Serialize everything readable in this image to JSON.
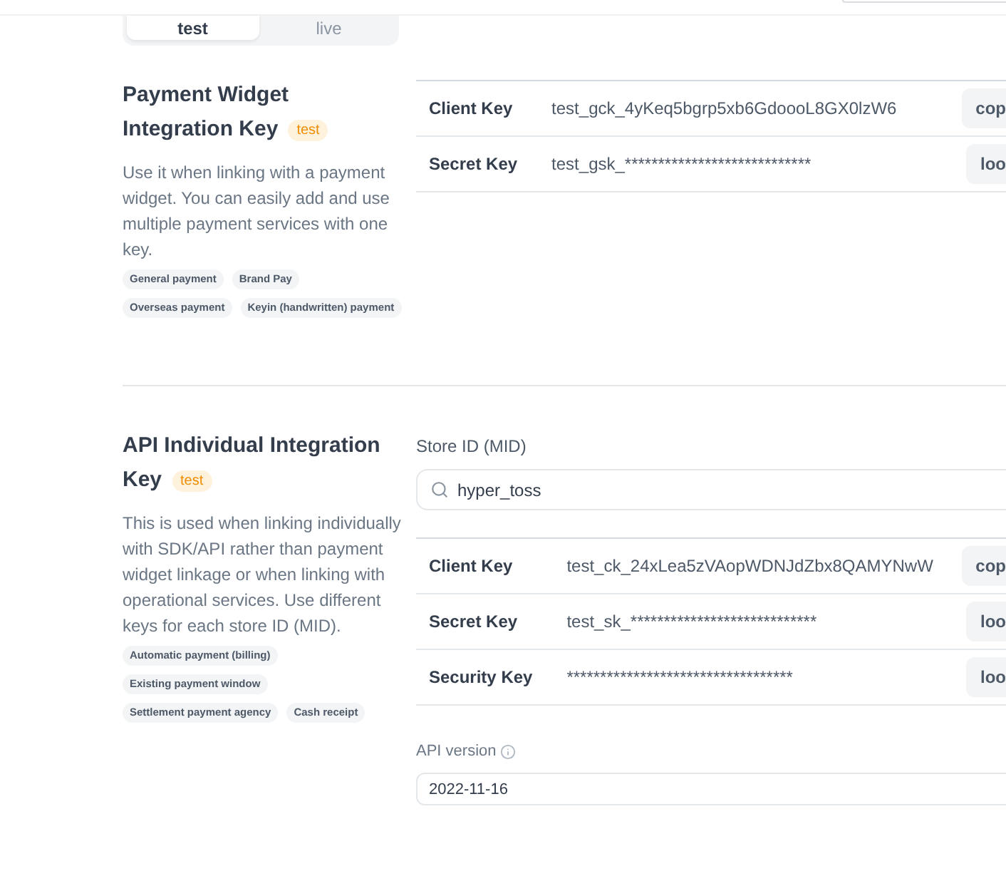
{
  "mode_tabs": [
    {
      "label": "test",
      "selected": true
    },
    {
      "label": "live",
      "selected": false
    }
  ],
  "sections": [
    {
      "title_lines": [
        "Payment Widget",
        "Integration Key"
      ],
      "badge": "test",
      "description": "Use it when linking with a payment widget. You can easily add and use multiple payment services with one key.",
      "tags": [
        "General payment",
        "Brand Pay",
        "Overseas payment",
        "Keyin (handwritten) payment"
      ],
      "keys": [
        {
          "label": "Client Key",
          "value": "test_gck_4yKeq5bgrp5xb6GdoooL8GX0lzW6",
          "action": "cop"
        },
        {
          "label": "Secret Key",
          "value": "test_gsk_****************************",
          "action": "loo"
        }
      ]
    },
    {
      "title_lines": [
        "API Individual Integration",
        "Key"
      ],
      "badge": "test",
      "description": "This is used when linking individually with SDK/API rather than payment widget linkage or when linking with operational services. Use different keys for each store ID (MID).",
      "tags": [
        "Automatic payment (billing)",
        "Existing payment window",
        "Settlement payment agency",
        "Cash receipt"
      ],
      "store_field": {
        "label": "Store ID (MID)",
        "value": "hyper_toss"
      },
      "keys": [
        {
          "label": "Client Key",
          "value": "test_ck_24xLea5zVAopWDNJdZbx8QAMYNwW",
          "action": "cop"
        },
        {
          "label": "Secret Key",
          "value": "test_sk_****************************",
          "action": "loo"
        },
        {
          "label": "Security Key",
          "value": "**********************************",
          "action": "loo"
        }
      ],
      "api_version": {
        "label": "API version",
        "value": "2022-11-16"
      }
    }
  ]
}
